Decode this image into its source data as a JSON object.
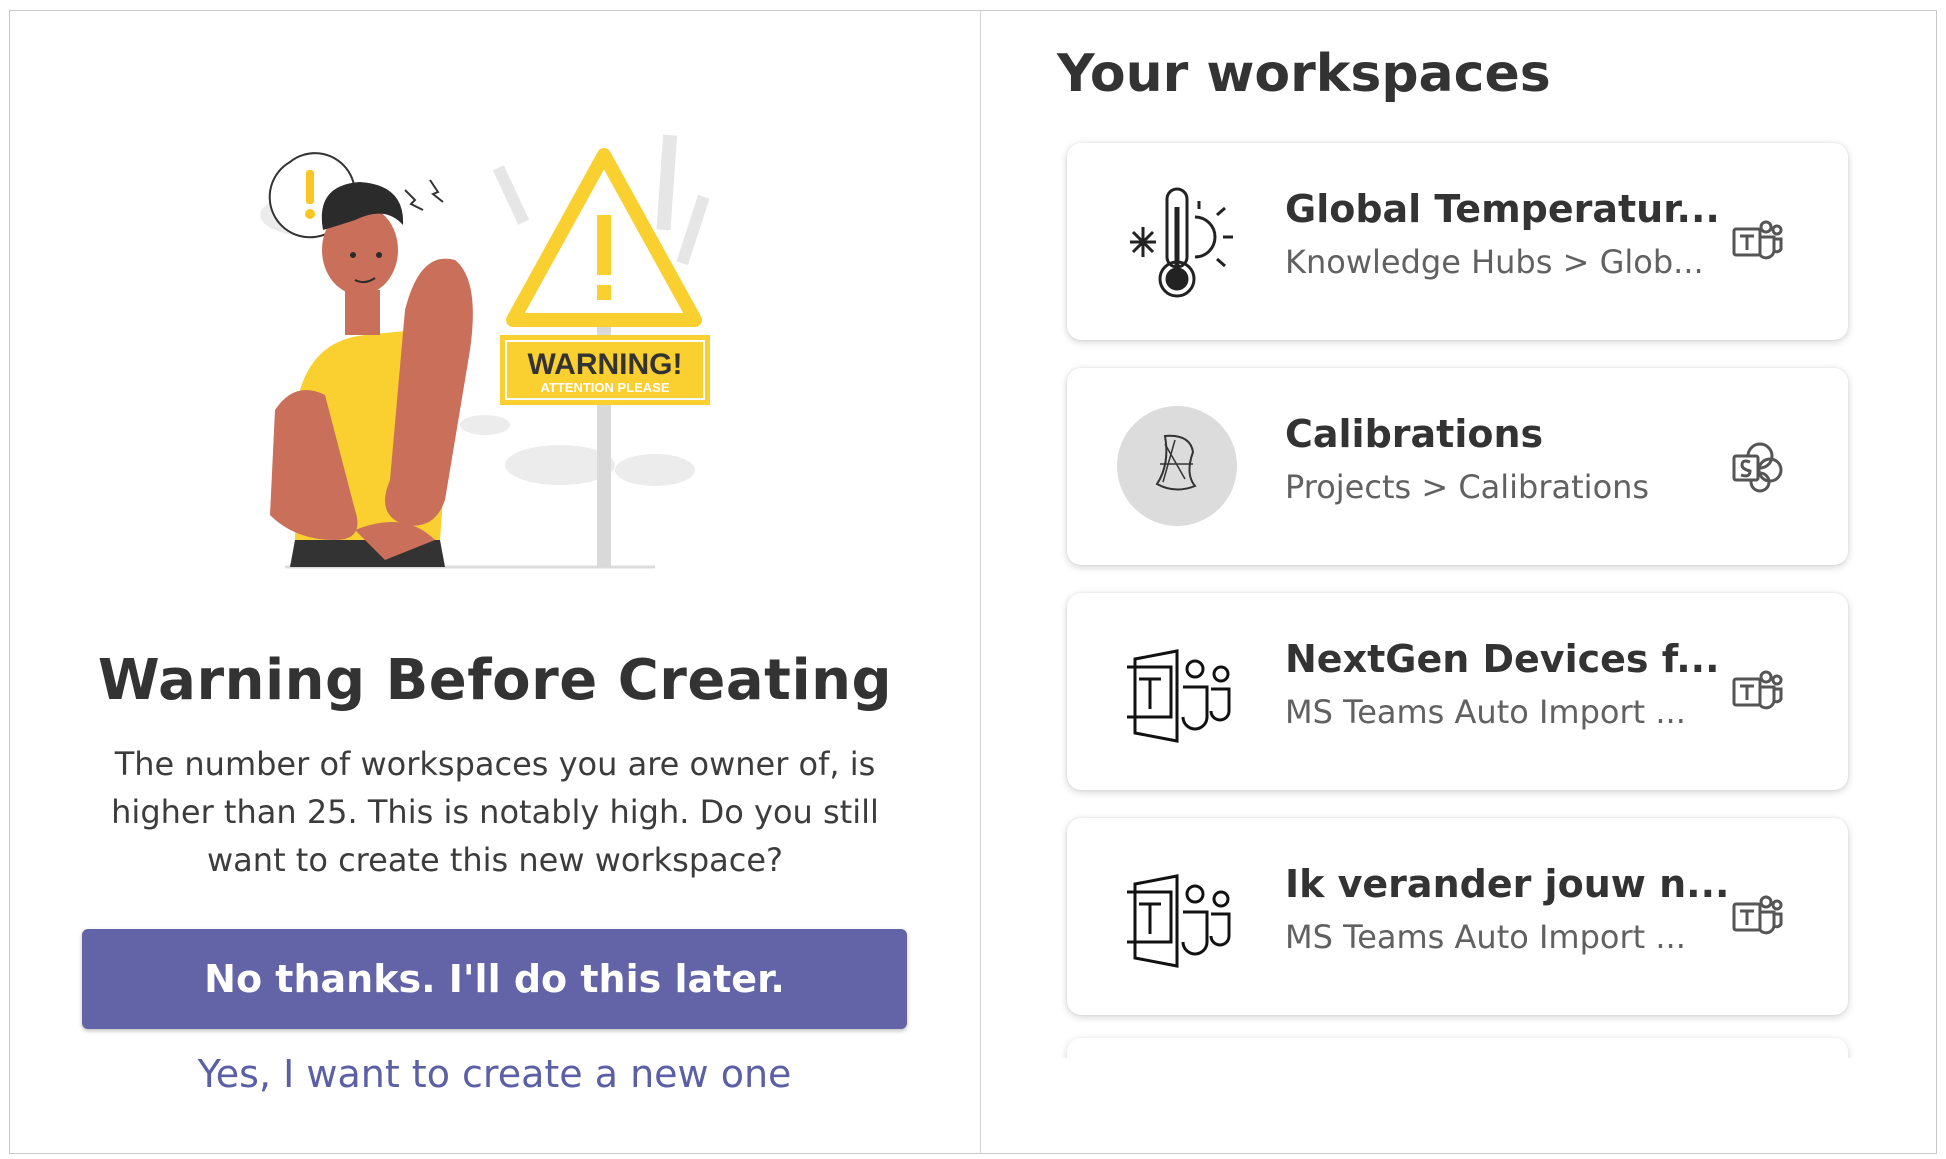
{
  "warning": {
    "title": "Warning Before Creating",
    "message": "The number of workspaces you are owner of, is higher than 25. This is notably high. Do you still want to create this new workspace?",
    "primary_button": "No thanks. I'll do this later.",
    "secondary_link": "Yes, I want to create a new one",
    "illustration": {
      "sign_text": "WARNING!",
      "sign_subtext": "ATTENTION PLEASE"
    }
  },
  "workspaces": {
    "title": "Your workspaces",
    "items": [
      {
        "name": "Global Temperatur...",
        "path": "Knowledge Hubs > Glob...",
        "icon": "thermometer-icon",
        "type_icon": "teams-icon"
      },
      {
        "name": "Calibrations",
        "path": "Projects > Calibrations",
        "icon": "calibration-logo-icon",
        "type_icon": "sharepoint-icon"
      },
      {
        "name": "NextGen Devices f...",
        "path": "MS Teams Auto Import ...",
        "icon": "teams-logo-icon",
        "type_icon": "teams-icon"
      },
      {
        "name": "Ik verander jouw n...",
        "path": "MS Teams Auto Import ...",
        "icon": "teams-logo-icon",
        "type_icon": "teams-icon"
      }
    ]
  },
  "colors": {
    "primary": "#6264a7",
    "illustration_yellow": "#f9d02f",
    "skin": "#c96f5a"
  }
}
